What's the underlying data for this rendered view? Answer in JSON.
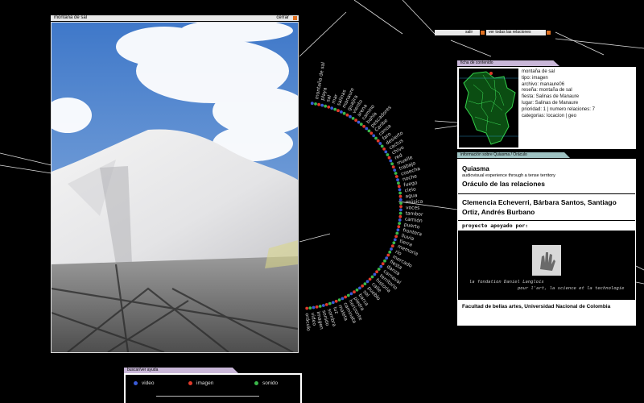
{
  "viewer": {
    "title": "montaña de sal",
    "close_label": "cerrar"
  },
  "top_links": {
    "exit": "salir",
    "all_relations": "ver todas las relaciones"
  },
  "content_sheet": {
    "tab": "ficha de contenido",
    "lines": [
      "montaña de sal",
      "tipo: imagen",
      "archivo: manaure06",
      "reseña: montaña de sal",
      "fiesta: Salinas de Manaure",
      "lugar: Salinas de Manaure",
      "prioridad: 1  |  numero relaciones: 7",
      "categorias: locacion | geo"
    ]
  },
  "info_panel": {
    "tab": "información sobre Quiasma / Oráculo",
    "title": "Quiasma",
    "subtitle": "audiovisual experience through a tense territory",
    "oracle": "Oráculo de las relaciones",
    "authors": "Clemencia Echeverri, Bárbara Santos, Santiago Ortiz, Andrés Burbano",
    "support_label": "proyecto apoyado por:",
    "foundation_line1": "la fondation Daniel Langlois",
    "foundation_line2": "pour l'art, la science et la technologie",
    "faculty": "Facultad de bellas artes, Universidad Nacional de Colombia"
  },
  "legend": {
    "tab": "buscar/ver ayuda",
    "items": [
      {
        "label": "video",
        "color": "#3a5bd8"
      },
      {
        "label": "imagen",
        "color": "#e03a2a"
      },
      {
        "label": "sonido",
        "color": "#3ab84a"
      }
    ]
  },
  "colors": {
    "accent": "#e07020",
    "tab_purple": "#b9a3c8",
    "tab_teal": "#9fc3c3",
    "lavender": "#c9b7d8"
  },
  "ring_words": [
    "montaña de sal",
    "playa",
    "sal",
    "mar",
    "salinas",
    "manaure",
    "guajira",
    "viento",
    "arena",
    "camino",
    "bahía",
    "pescadores",
    "Caribe",
    "canoa",
    "faro",
    "desierto",
    "cactus",
    "chivo",
    "red",
    "muelle",
    "trabajo",
    "cosecha",
    "noche",
    "fuego",
    "cielo",
    "agua",
    "música",
    "voces",
    "tambor",
    "camión",
    "puerto",
    "frontera",
    "lluvia",
    "tierra",
    "memoria",
    "río",
    "mercado",
    "fiesta",
    "danza",
    "carnaval",
    "territorio",
    "historia",
    "calle",
    "pueblo",
    "sol",
    "barca",
    "piedra",
    "horizonte",
    "caminata",
    "maleta",
    "luz",
    "sombra",
    "sonido",
    "imagen",
    "video",
    "oráculo"
  ]
}
